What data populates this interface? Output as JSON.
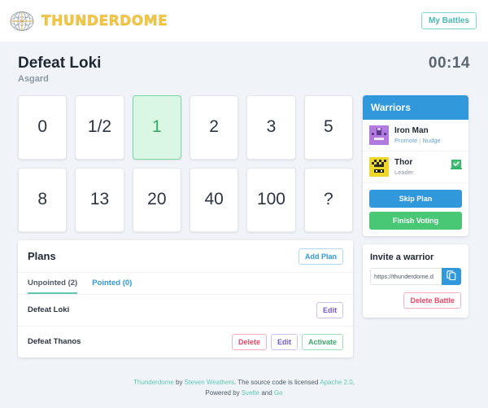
{
  "navbar": {
    "brand_text": "THUNDERDOME",
    "brand_icon": "dome-logo-icon",
    "my_battles_label": "My Battles"
  },
  "battle": {
    "title": "Defeat Loki",
    "subtitle": "Asgard",
    "timer": "00:14"
  },
  "vote_cards": {
    "row1": [
      "0",
      "1/2",
      "1",
      "2",
      "3",
      "5"
    ],
    "row2": [
      "8",
      "13",
      "20",
      "40",
      "100",
      "?"
    ],
    "selected": "1"
  },
  "plans": {
    "title": "Plans",
    "add_label": "Add Plan",
    "tabs": [
      {
        "label": "Unpointed (2)",
        "active": true
      },
      {
        "label": "Pointed (0)",
        "active": false
      }
    ],
    "rows": [
      {
        "name": "Defeat Loki",
        "actions": [
          {
            "label": "Edit",
            "kind": "edit"
          }
        ]
      },
      {
        "name": "Defeat Thanos",
        "actions": [
          {
            "label": "Delete",
            "kind": "delete"
          },
          {
            "label": "Edit",
            "kind": "edit"
          },
          {
            "label": "Activate",
            "kind": "activate"
          }
        ]
      }
    ]
  },
  "warriors": {
    "header": "Warriors",
    "list": [
      {
        "name": "Iron Man",
        "role": "",
        "promote_label": "Promote",
        "separator": "|",
        "nudge_label": "Nudge",
        "avatar_color": "#b07ae0",
        "avatar_name": "avatar-iron-man",
        "voted": false
      },
      {
        "name": "Thor",
        "role": "Leader",
        "avatar_color": "#eed62a",
        "avatar_name": "avatar-thor",
        "voted": true,
        "vote_badge_name": "vote-check-badge"
      }
    ],
    "skip_label": "Skip Plan",
    "finish_label": "Finish Voting"
  },
  "invite": {
    "title": "Invite a warrior",
    "url_value": "https://thunderdome.d",
    "url_placeholder": "https://thunderdome.d",
    "copy_icon": "copy-icon",
    "delete_label": "Delete Battle"
  },
  "footer": {
    "brand_link": "Thunderdome",
    "by_text": " by ",
    "author_link": "Steven Weathers",
    "license_text": ". The source code is licensed ",
    "license_link": "Apache 2.0",
    "license_end": ".",
    "powered_text": "Powered by ",
    "svelte_link": "Svelte",
    "and_text": " and ",
    "go_link": "Go"
  },
  "colors": {
    "brand_yellow": "#f2c744",
    "blue": "#3298dc",
    "green": "#48c774",
    "red": "#f14668",
    "purple": "#7957d5",
    "teal": "#5fc9b0",
    "selected_card_bg": "#d9f7e3"
  }
}
